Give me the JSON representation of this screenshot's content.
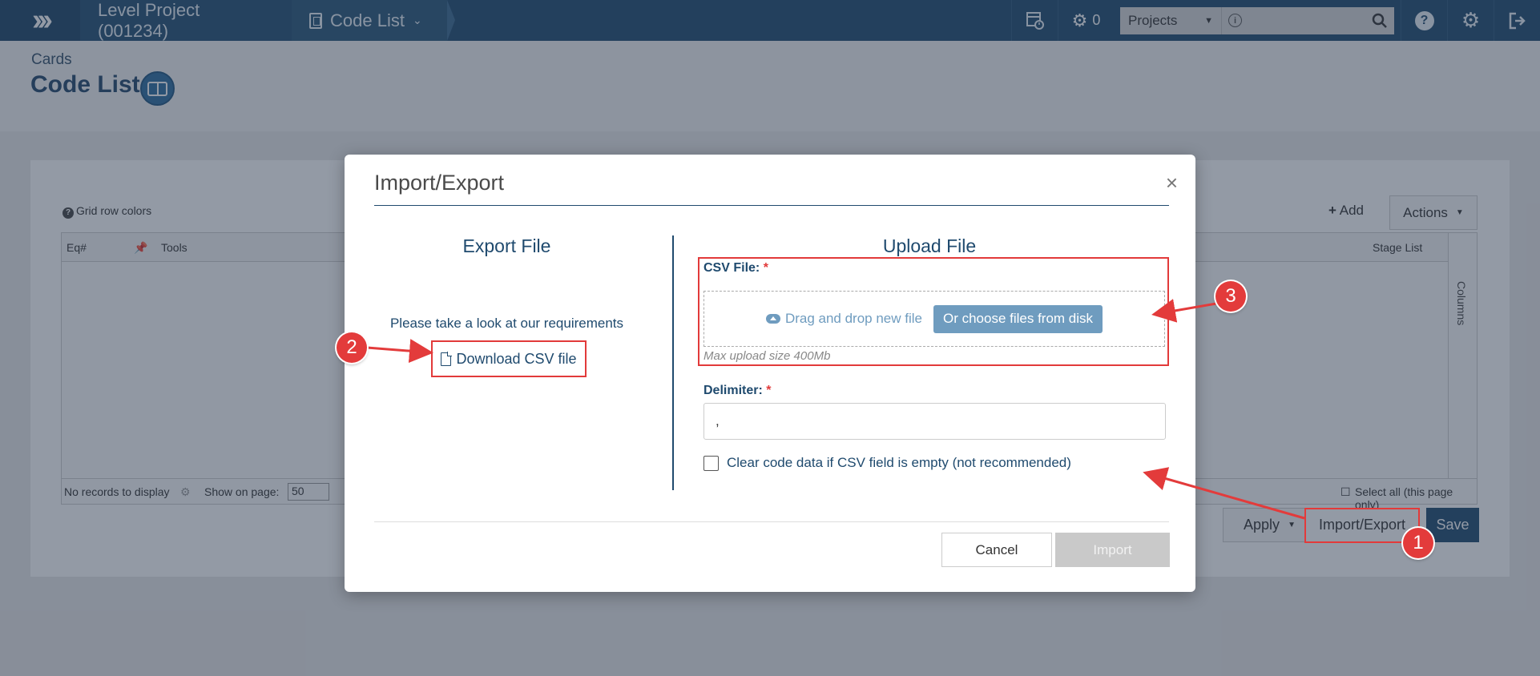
{
  "topbar": {
    "project_crumb": "Level Project (001234)",
    "page_crumb": "Code List",
    "gear_count": "0",
    "projects_select": "Projects"
  },
  "header": {
    "section": "Cards",
    "title": "Code List"
  },
  "panel": {
    "grid_row_colors": "Grid row colors",
    "add_label": "Add",
    "actions_label": "Actions",
    "columns": [
      "Eq#",
      "Tools",
      "Stage List"
    ],
    "no_records": "No records to display",
    "show_on_page": "Show on page:",
    "page_size": "50",
    "columns_rail": "Columns",
    "select_all": "Select all (this page only)",
    "apply_label": "Apply",
    "import_export_label": "Import/Export",
    "save_label": "Save"
  },
  "modal": {
    "title": "Import/Export",
    "close": "×",
    "export_title": "Export File",
    "requirements_text": "Please take a look at our requirements",
    "download_label": "Download CSV file",
    "upload_title": "Upload File",
    "csv_label": "CSV File:",
    "required_mark": "*",
    "drag_drop_text": "Drag and drop new file",
    "choose_files_label": "Or choose files from disk",
    "max_size_text": "Max upload size 400Mb",
    "delimiter_label": "Delimiter:",
    "delimiter_value": ",",
    "clear_checkbox_label": "Clear code data if CSV field is empty (not recommended)",
    "cancel_label": "Cancel",
    "import_label": "Import"
  },
  "callouts": [
    "1",
    "2",
    "3"
  ],
  "colors": {
    "brand": "#1f4a6e",
    "annotation_red": "#e23a3a",
    "upload_accent": "#6f9cbf"
  }
}
